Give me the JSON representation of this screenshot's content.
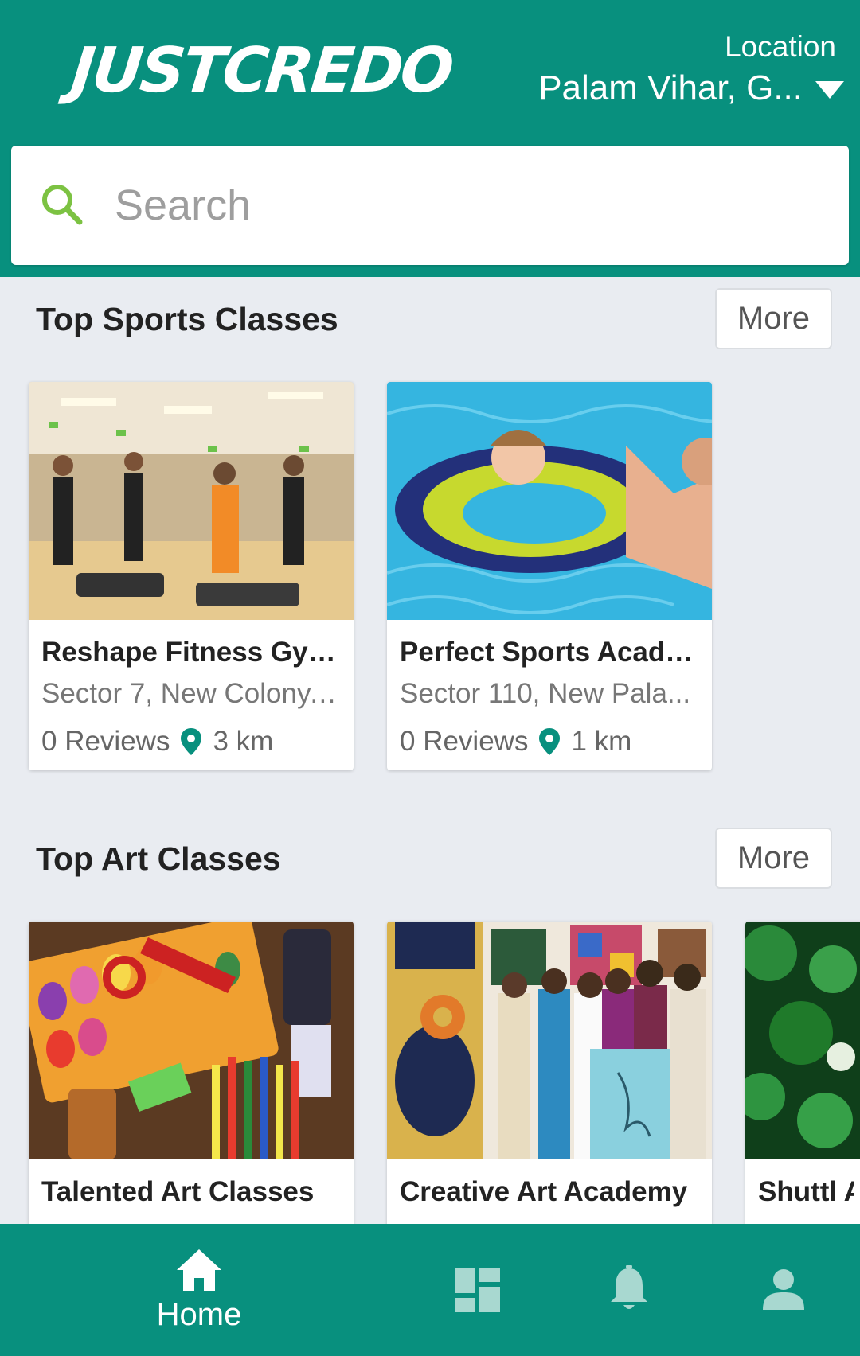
{
  "header": {
    "logo": "JUSTCREDO",
    "location_label": "Location",
    "location_value": "Palam Vihar, G...",
    "caret_icon": "chevron-down-icon"
  },
  "search": {
    "placeholder": "Search",
    "value": ""
  },
  "sections": {
    "sports": {
      "title": "Top Sports Classes",
      "more_label": "More",
      "cards": [
        {
          "name": "Reshape Fitness Gym...",
          "address": "Sector 7, New Colony, ...",
          "reviews": "0 Reviews",
          "distance": "3 km"
        },
        {
          "name": "Perfect Sports Acade...",
          "address": "Sector 110, New Pala...",
          "reviews": "0 Reviews",
          "distance": "1 km"
        }
      ]
    },
    "art": {
      "title": "Top Art Classes",
      "more_label": "More",
      "cards": [
        {
          "name": "Talented Art Classes"
        },
        {
          "name": "Creative Art Academy"
        },
        {
          "name": "Shuttl A"
        }
      ]
    }
  },
  "bottom_nav": {
    "home_label": "Home",
    "icons": [
      "home-icon",
      "dashboard-icon",
      "bell-icon",
      "profile-icon"
    ]
  },
  "colors": {
    "primary": "#08907e",
    "search_icon": "#7cc242",
    "background": "#e9ecf1"
  }
}
